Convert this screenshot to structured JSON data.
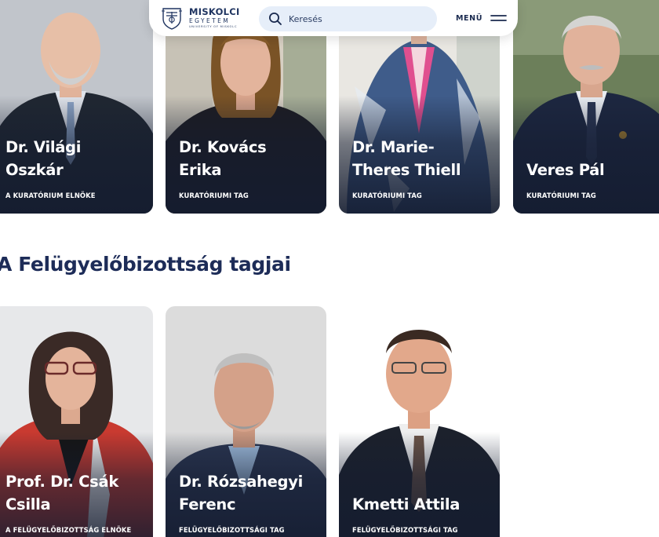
{
  "header": {
    "logo": {
      "main": "MISKOLCI",
      "sub": "EGYETEM",
      "tiny": "UNIVERSITY OF MISKOLC"
    },
    "search": {
      "placeholder": "Keresés"
    },
    "menu_label": "MENÜ"
  },
  "board": {
    "members": [
      {
        "name_line1": "Dr. Világi",
        "name_line2": "Oszkár",
        "role": "A KURATÓRIUM ELNÖKE"
      },
      {
        "name_line1": "Dr. Kovács",
        "name_line2": "Erika",
        "role": "KURATÓRIUMI TAG"
      },
      {
        "name_line1": "Dr. Marie-",
        "name_line2": "Theres Thiell",
        "role": "KURATÓRIUMI TAG"
      },
      {
        "name_line1": "Veres Pál",
        "name_line2": "",
        "role": "KURATÓRIUMI TAG"
      }
    ]
  },
  "supervisory": {
    "title": "A Felügyelőbizottság tagjai",
    "members": [
      {
        "name_line1": "Prof. Dr. Csák",
        "name_line2": "Csilla",
        "role": "A FELÜGYELŐBIZOTTSÁG ELNÖKE"
      },
      {
        "name_line1": "Dr. Rózsahegyi",
        "name_line2": "Ferenc",
        "role": "FELÜGYELŐBIZOTTSÁGI TAG"
      },
      {
        "name_line1": "Kmetti Attila",
        "name_line2": "",
        "role": "FELÜGYELŐBIZOTTSÁGI TAG"
      }
    ]
  },
  "colors": {
    "brand_navy": "#1d2c58",
    "search_bg": "#e6eef9",
    "card_overlay": "#141c30"
  }
}
